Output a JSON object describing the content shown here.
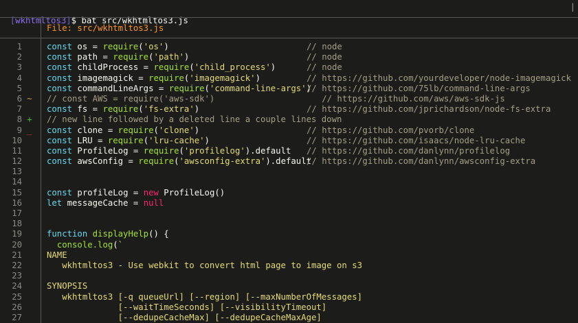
{
  "terminal": {
    "prompt_open": "[",
    "prompt_host": "wkhtmltos3",
    "prompt_close": "]",
    "prompt_symbol": "$ ",
    "command": "bat src/wkhtmltos3.js",
    "scroll_mark": "|"
  },
  "file_header": "File: src/wkhtmltos3.js",
  "lines": [
    {
      "n": "1",
      "marker": "",
      "parts": [
        [
          "kw",
          "const"
        ],
        [
          "p",
          " os = "
        ],
        [
          "fn",
          "require"
        ],
        [
          "p",
          "("
        ],
        [
          "str",
          "'os'"
        ],
        [
          "p",
          ")"
        ]
      ],
      "comment": "// node"
    },
    {
      "n": "2",
      "marker": "",
      "parts": [
        [
          "kw",
          "const"
        ],
        [
          "p",
          " path = "
        ],
        [
          "fn",
          "require"
        ],
        [
          "p",
          "("
        ],
        [
          "str",
          "'path'"
        ],
        [
          "p",
          ")"
        ]
      ],
      "comment": "// node"
    },
    {
      "n": "3",
      "marker": "",
      "parts": [
        [
          "kw",
          "const"
        ],
        [
          "p",
          " childProcess = "
        ],
        [
          "fn",
          "require"
        ],
        [
          "p",
          "("
        ],
        [
          "str",
          "'child_process'"
        ],
        [
          "p",
          ")"
        ]
      ],
      "comment": "// node"
    },
    {
      "n": "4",
      "marker": "",
      "parts": [
        [
          "kw",
          "const"
        ],
        [
          "p",
          " imagemagick = "
        ],
        [
          "fn",
          "require"
        ],
        [
          "p",
          "("
        ],
        [
          "str",
          "'imagemagick'"
        ],
        [
          "p",
          ")"
        ]
      ],
      "comment": "// https://github.com/yourdeveloper/node-imagemagick"
    },
    {
      "n": "5",
      "marker": "",
      "parts": [
        [
          "kw",
          "const"
        ],
        [
          "p",
          " commandLineArgs = "
        ],
        [
          "fn",
          "require"
        ],
        [
          "p",
          "("
        ],
        [
          "str",
          "'command-line-args'"
        ],
        [
          "p",
          ")"
        ]
      ],
      "comment": "// https://github.com/75lb/command-line-args"
    },
    {
      "n": "6",
      "marker": "~",
      "parts": [
        [
          "cmt",
          "// const AWS = require('aws-sdk')"
        ]
      ],
      "comment": "   // https://github.com/aws/aws-sdk-js"
    },
    {
      "n": "7",
      "marker": "",
      "parts": [
        [
          "kw",
          "const"
        ],
        [
          "p",
          " fs = "
        ],
        [
          "fn",
          "require"
        ],
        [
          "p",
          "("
        ],
        [
          "str",
          "'fs-extra'"
        ],
        [
          "p",
          ")"
        ]
      ],
      "comment": "// https://github.com/jprichardson/node-fs-extra"
    },
    {
      "n": "8",
      "marker": "+",
      "parts": [
        [
          "cmt",
          "// new line followed by a deleted line a couple lines down"
        ]
      ],
      "comment": ""
    },
    {
      "n": "9",
      "marker": "_",
      "parts": [
        [
          "kw",
          "const"
        ],
        [
          "p",
          " clone = "
        ],
        [
          "fn",
          "require"
        ],
        [
          "p",
          "("
        ],
        [
          "str",
          "'clone'"
        ],
        [
          "p",
          ")"
        ]
      ],
      "comment": "// https://github.com/pvorb/clone"
    },
    {
      "n": "10",
      "marker": "",
      "parts": [
        [
          "kw",
          "const"
        ],
        [
          "p",
          " LRU = "
        ],
        [
          "fn",
          "require"
        ],
        [
          "p",
          "("
        ],
        [
          "str",
          "'lru-cache'"
        ],
        [
          "p",
          ")"
        ]
      ],
      "comment": "// https://github.com/isaacs/node-lru-cache"
    },
    {
      "n": "11",
      "marker": "",
      "parts": [
        [
          "kw",
          "const"
        ],
        [
          "p",
          " ProfileLog = "
        ],
        [
          "fn",
          "require"
        ],
        [
          "p",
          "("
        ],
        [
          "str",
          "'profilelog'"
        ],
        [
          "p",
          ").default"
        ]
      ],
      "comment": "// https://github.com/danlynn/profilelog"
    },
    {
      "n": "12",
      "marker": "",
      "parts": [
        [
          "kw",
          "const"
        ],
        [
          "p",
          " awsConfig = "
        ],
        [
          "fn",
          "require"
        ],
        [
          "p",
          "("
        ],
        [
          "str",
          "'awsconfig-extra'"
        ],
        [
          "p",
          ").default"
        ]
      ],
      "comment": "// https://github.com/danlynn/awsconfig-extra"
    },
    {
      "n": "13",
      "marker": "",
      "parts": [],
      "comment": ""
    },
    {
      "n": "14",
      "marker": "",
      "parts": [],
      "comment": ""
    },
    {
      "n": "15",
      "marker": "",
      "parts": [
        [
          "kw",
          "const"
        ],
        [
          "p",
          " profileLog = "
        ],
        [
          "kw2",
          "new"
        ],
        [
          "p",
          " ProfileLog()"
        ]
      ],
      "comment": ""
    },
    {
      "n": "16",
      "marker": "",
      "parts": [
        [
          "kw",
          "let"
        ],
        [
          "p",
          " messageCache = "
        ],
        [
          "kw2",
          "null"
        ]
      ],
      "comment": ""
    },
    {
      "n": "17",
      "marker": "",
      "parts": [],
      "comment": ""
    },
    {
      "n": "18",
      "marker": "",
      "parts": [],
      "comment": ""
    },
    {
      "n": "19",
      "marker": "",
      "parts": [
        [
          "kw",
          "function"
        ],
        [
          "p",
          " "
        ],
        [
          "fn",
          "displayHelp"
        ],
        [
          "p",
          "() {"
        ]
      ],
      "comment": ""
    },
    {
      "n": "20",
      "marker": "",
      "parts": [
        [
          "p",
          "  "
        ],
        [
          "fn",
          "console.log"
        ],
        [
          "p",
          "("
        ],
        [
          "str",
          "`"
        ]
      ],
      "comment": ""
    },
    {
      "n": "21",
      "marker": "",
      "parts": [
        [
          "str",
          "NAME"
        ]
      ],
      "comment": ""
    },
    {
      "n": "22",
      "marker": "",
      "parts": [
        [
          "str",
          "   wkhtmltos3 - Use webkit to convert html page to image on s3"
        ]
      ],
      "comment": ""
    },
    {
      "n": "23",
      "marker": "",
      "parts": [],
      "comment": ""
    },
    {
      "n": "24",
      "marker": "",
      "parts": [
        [
          "str",
          "SYNOPSIS"
        ]
      ],
      "comment": ""
    },
    {
      "n": "25",
      "marker": "",
      "parts": [
        [
          "str",
          "   wkhtmltos3 [-q queueUrl] [--region] [--maxNumberOfMessages]"
        ]
      ],
      "comment": ""
    },
    {
      "n": "26",
      "marker": "",
      "parts": [
        [
          "str",
          "              [--waitTimeSeconds] [--visibilityTimeout]"
        ]
      ],
      "comment": ""
    },
    {
      "n": "27",
      "marker": "",
      "parts": [
        [
          "str",
          "              [--dedupeCacheMax] [--dedupeCacheMaxAge]"
        ]
      ],
      "comment": ""
    }
  ]
}
